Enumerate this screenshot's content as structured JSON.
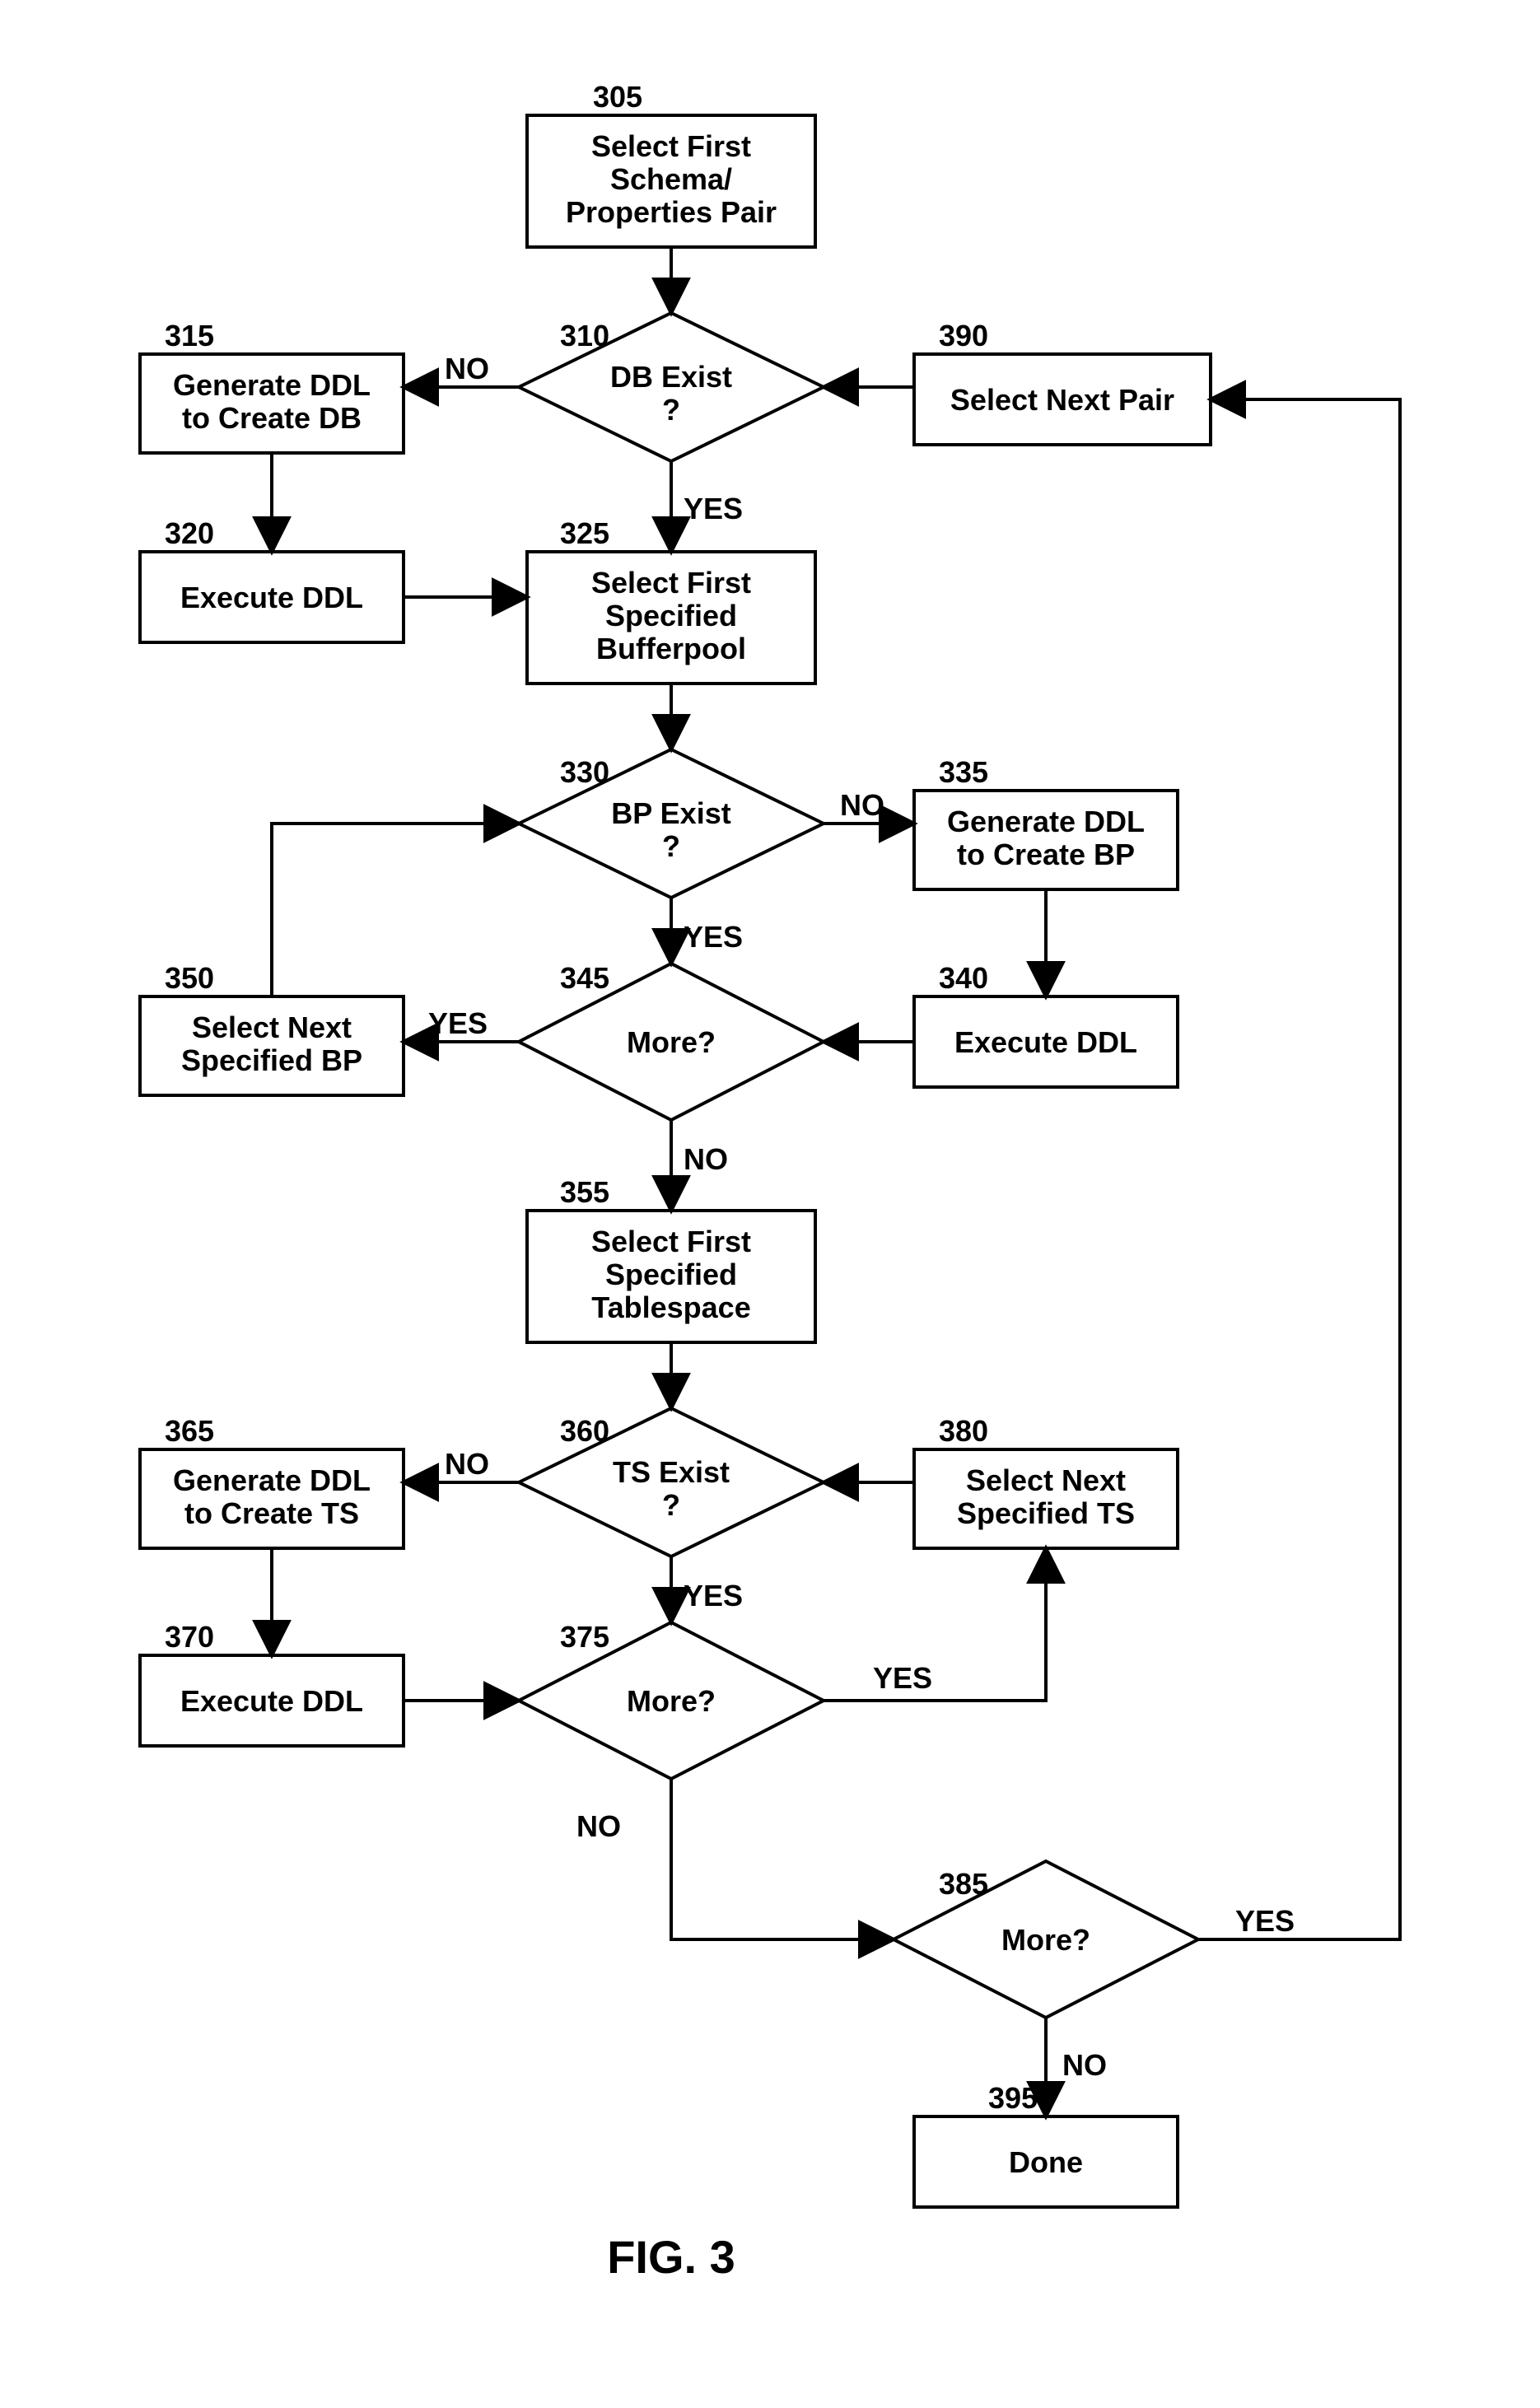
{
  "figure_label": "FIG. 3",
  "nodes": {
    "n305": {
      "num": "305",
      "lines": [
        "Select First",
        "Schema/",
        "Properties Pair"
      ]
    },
    "n310": {
      "num": "310",
      "lines": [
        "DB Exist",
        "?"
      ]
    },
    "n315": {
      "num": "315",
      "lines": [
        "Generate DDL",
        "to Create DB"
      ]
    },
    "n320": {
      "num": "320",
      "lines": [
        "Execute DDL"
      ]
    },
    "n325": {
      "num": "325",
      "lines": [
        "Select First",
        "Specified",
        "Bufferpool"
      ]
    },
    "n330": {
      "num": "330",
      "lines": [
        "BP Exist",
        "?"
      ]
    },
    "n335": {
      "num": "335",
      "lines": [
        "Generate DDL",
        "to Create BP"
      ]
    },
    "n340": {
      "num": "340",
      "lines": [
        "Execute DDL"
      ]
    },
    "n345": {
      "num": "345",
      "lines": [
        "More?"
      ]
    },
    "n350": {
      "num": "350",
      "lines": [
        "Select Next",
        "Specified BP"
      ]
    },
    "n355": {
      "num": "355",
      "lines": [
        "Select First",
        "Specified",
        "Tablespace"
      ]
    },
    "n360": {
      "num": "360",
      "lines": [
        "TS Exist",
        "?"
      ]
    },
    "n365": {
      "num": "365",
      "lines": [
        "Generate DDL",
        "to Create TS"
      ]
    },
    "n370": {
      "num": "370",
      "lines": [
        "Execute DDL"
      ]
    },
    "n375": {
      "num": "375",
      "lines": [
        "More?"
      ]
    },
    "n380": {
      "num": "380",
      "lines": [
        "Select Next",
        "Specified TS"
      ]
    },
    "n385": {
      "num": "385",
      "lines": [
        "More?"
      ]
    },
    "n390": {
      "num": "390",
      "lines": [
        "Select Next Pair"
      ]
    },
    "n395": {
      "num": "395",
      "lines": [
        "Done"
      ]
    }
  },
  "edge_labels": {
    "no": "NO",
    "yes": "YES"
  }
}
